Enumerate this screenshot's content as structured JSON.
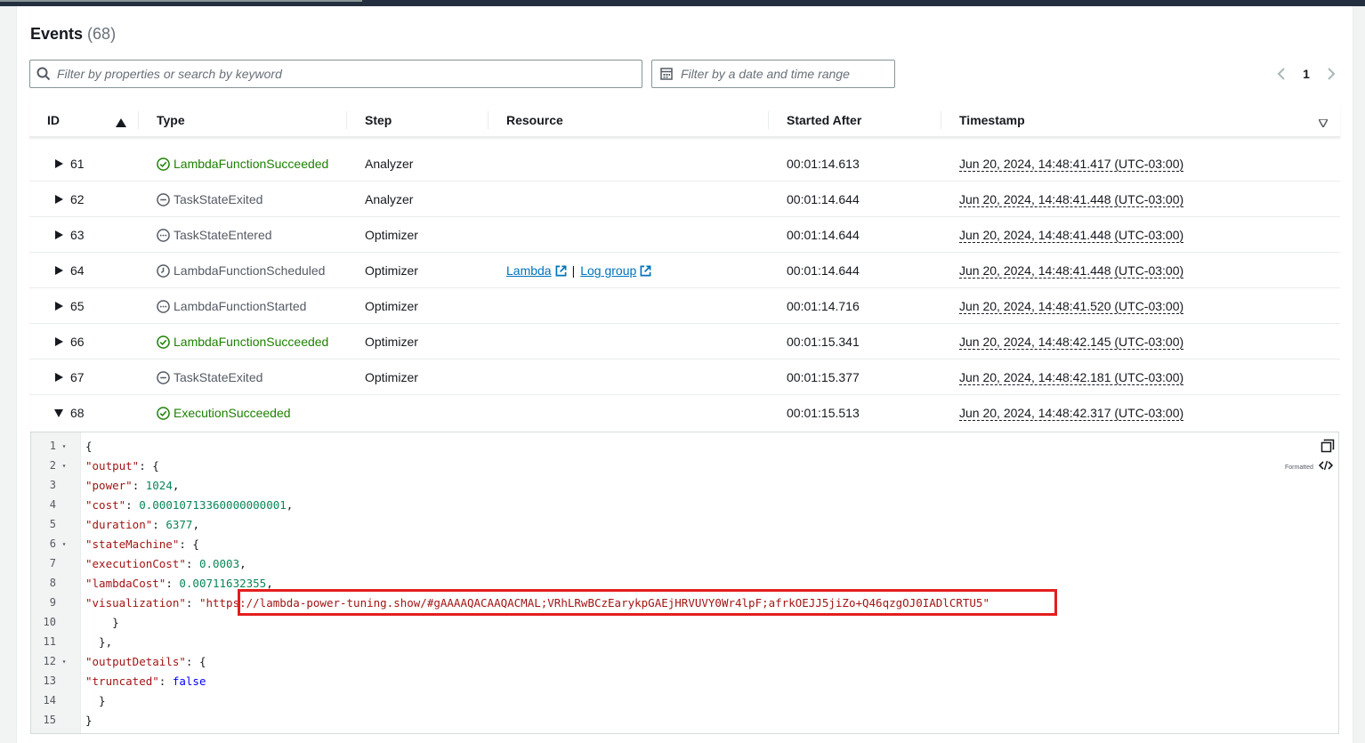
{
  "header": {
    "title": "Events",
    "count": "(68)"
  },
  "search": {
    "placeholder": "Filter by properties or search by keyword"
  },
  "date_filter": {
    "placeholder": "Filter by a date and time range"
  },
  "pagination": {
    "current_page": "1"
  },
  "columns": {
    "id": "ID",
    "type": "Type",
    "step": "Step",
    "resource": "Resource",
    "started_after": "Started After",
    "timestamp": "Timestamp"
  },
  "rows": [
    {
      "id": "61",
      "type": "LambdaFunctionSucceeded",
      "status": "success",
      "step": "Analyzer",
      "started_after": "00:01:14.613",
      "timestamp": "Jun 20, 2024, 14:48:41.417 (UTC-03:00)"
    },
    {
      "id": "62",
      "type": "TaskStateExited",
      "status": "exited",
      "step": "Analyzer",
      "started_after": "00:01:14.644",
      "timestamp": "Jun 20, 2024, 14:48:41.448 (UTC-03:00)"
    },
    {
      "id": "63",
      "type": "TaskStateEntered",
      "status": "entered",
      "step": "Optimizer",
      "started_after": "00:01:14.644",
      "timestamp": "Jun 20, 2024, 14:48:41.448 (UTC-03:00)"
    },
    {
      "id": "64",
      "type": "LambdaFunctionScheduled",
      "status": "scheduled",
      "step": "Optimizer",
      "resource_lambda": "Lambda",
      "resource_log": "Log group",
      "started_after": "00:01:14.644",
      "timestamp": "Jun 20, 2024, 14:48:41.448 (UTC-03:00)"
    },
    {
      "id": "65",
      "type": "LambdaFunctionStarted",
      "status": "started",
      "step": "Optimizer",
      "started_after": "00:01:14.716",
      "timestamp": "Jun 20, 2024, 14:48:41.520 (UTC-03:00)"
    },
    {
      "id": "66",
      "type": "LambdaFunctionSucceeded",
      "status": "success",
      "step": "Optimizer",
      "started_after": "00:01:15.341",
      "timestamp": "Jun 20, 2024, 14:48:42.145 (UTC-03:00)"
    },
    {
      "id": "67",
      "type": "TaskStateExited",
      "status": "exited",
      "step": "Optimizer",
      "started_after": "00:01:15.377",
      "timestamp": "Jun 20, 2024, 14:48:42.181 (UTC-03:00)"
    },
    {
      "id": "68",
      "type": "ExecutionSucceeded",
      "status": "success",
      "step": "",
      "started_after": "00:01:15.513",
      "timestamp": "Jun 20, 2024, 14:48:42.317 (UTC-03:00)"
    }
  ],
  "code_viewer": {
    "mode_label": "Formatted",
    "lines": [
      {
        "num": "1",
        "fold": "▾"
      },
      {
        "num": "2",
        "fold": "▾"
      },
      {
        "num": "3",
        "fold": ""
      },
      {
        "num": "4",
        "fold": ""
      },
      {
        "num": "5",
        "fold": ""
      },
      {
        "num": "6",
        "fold": "▾"
      },
      {
        "num": "7",
        "fold": ""
      },
      {
        "num": "8",
        "fold": ""
      },
      {
        "num": "9",
        "fold": ""
      },
      {
        "num": "10",
        "fold": ""
      },
      {
        "num": "11",
        "fold": ""
      },
      {
        "num": "12",
        "fold": "▾"
      },
      {
        "num": "13",
        "fold": ""
      },
      {
        "num": "14",
        "fold": ""
      },
      {
        "num": "15",
        "fold": ""
      }
    ],
    "json": {
      "output_key": "\"output\"",
      "power_key": "\"power\"",
      "power_val": "1024",
      "cost_key": "\"cost\"",
      "cost_val": "0.00010713360000000001",
      "duration_key": "\"duration\"",
      "duration_val": "6377",
      "statemachine_key": "\"stateMachine\"",
      "executioncost_key": "\"executionCost\"",
      "executioncost_val": "0.0003",
      "lambdacost_key": "\"lambdaCost\"",
      "lambdacost_val": "0.00711632355",
      "visualization_key": "\"visualization\"",
      "visualization_val": "\"https://lambda-power-tuning.show/#gAAAAQACAAQACMAL;VRhLRwBCzEarykpGAEjHRVUVY0Wr4lpF;afrkOEJJ5jiZo+Q46qzgOJ0IADlCRTU5\"",
      "outputdetails_key": "\"outputDetails\"",
      "truncated_key": "\"truncated\"",
      "truncated_val": "false"
    }
  },
  "colors": {
    "success": "#1d8102",
    "link": "#0073bb",
    "highlight": "#e41e1e"
  }
}
